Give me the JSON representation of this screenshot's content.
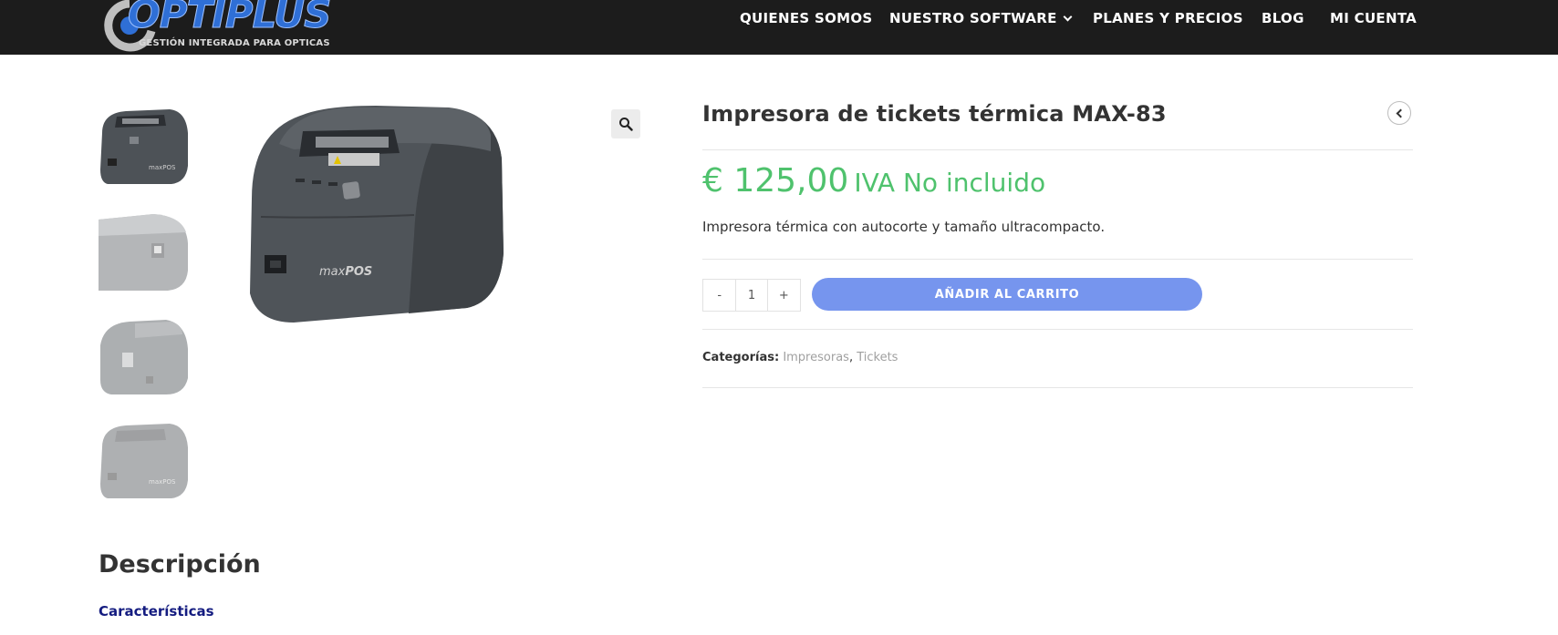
{
  "brand": {
    "name": "OPTIPLUS",
    "tagline": "GESTIÓN INTEGRADA PARA OPTICAS",
    "logo_color": "#2f6fd6"
  },
  "nav": {
    "items": [
      {
        "label": "QUIENES SOMOS"
      },
      {
        "label": "NUESTRO SOFTWARE",
        "icon": "chevron-down-icon"
      },
      {
        "label": "PLANES Y PRECIOS"
      },
      {
        "label": "BLOG"
      },
      {
        "label": "MI CUENTA"
      }
    ]
  },
  "gallery": {
    "zoom_icon": "search-icon",
    "thumbnails": [
      {
        "name": "printer-front",
        "active": true
      },
      {
        "name": "printer-side",
        "active": false
      },
      {
        "name": "printer-open",
        "active": false
      },
      {
        "name": "printer-angle",
        "active": false
      }
    ]
  },
  "product": {
    "title": "Impresora de tickets térmica MAX-83",
    "price": "€ 125,00",
    "price_suffix": "IVA No incluido",
    "price_color": "#4fc26d",
    "short_description": "Impresora térmica con autocorte y tamaño ultracompacto.",
    "quantity": {
      "minus": "-",
      "value": "1",
      "plus": "+"
    },
    "add_to_cart": "AÑADIR AL CARRITO",
    "button_color": "#7695ee",
    "categories_label": "Categorías:",
    "categories": [
      "Impresoras",
      "Tickets"
    ],
    "category_separator": ","
  },
  "tabs": {
    "description_heading": "Descripción",
    "features_heading": "Características"
  }
}
